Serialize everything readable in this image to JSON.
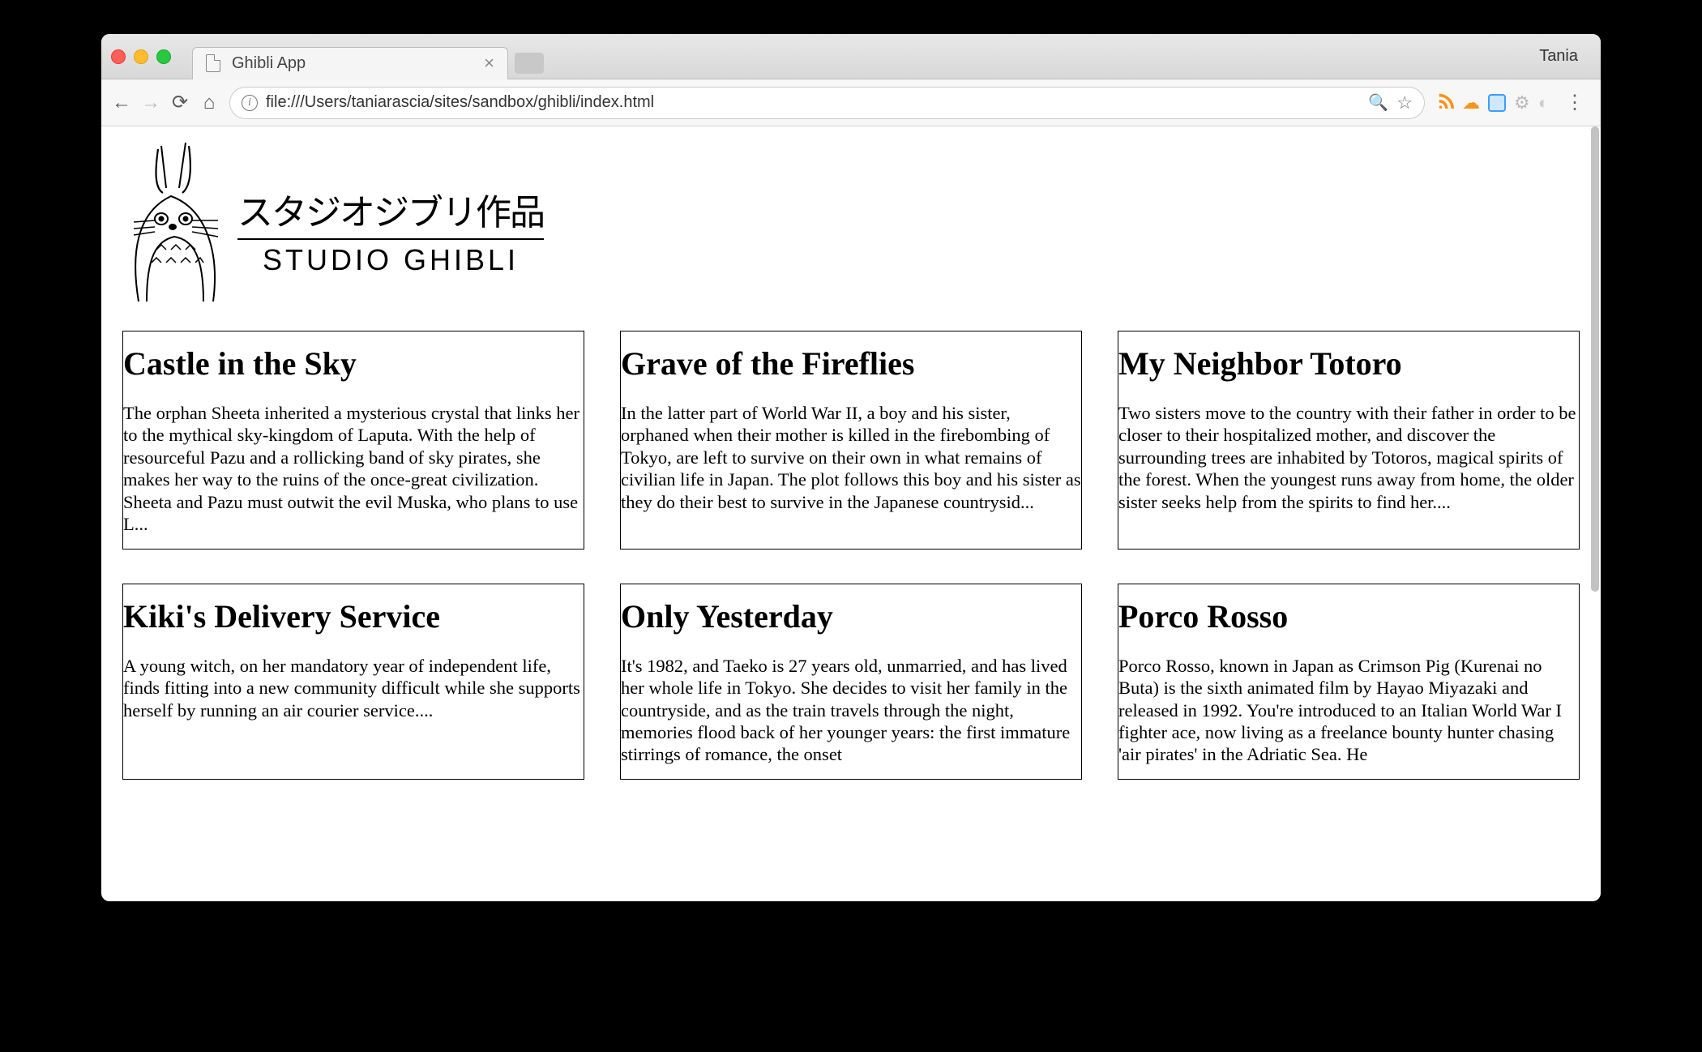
{
  "browser": {
    "tab_title": "Ghibli App",
    "profile_name": "Tania",
    "url": "file:///Users/taniarascia/sites/sandbox/ghibli/index.html"
  },
  "logo": {
    "japanese": "スタジオジブリ作品",
    "english": "STUDIO GHIBLI"
  },
  "films": [
    {
      "title": "Castle in the Sky",
      "description": "The orphan Sheeta inherited a mysterious crystal that links her to the mythical sky-kingdom of Laputa. With the help of resourceful Pazu and a rollicking band of sky pirates, she makes her way to the ruins of the once-great civilization. Sheeta and Pazu must outwit the evil Muska, who plans to use L..."
    },
    {
      "title": "Grave of the Fireflies",
      "description": "In the latter part of World War II, a boy and his sister, orphaned when their mother is killed in the firebombing of Tokyo, are left to survive on their own in what remains of civilian life in Japan. The plot follows this boy and his sister as they do their best to survive in the Japanese countrysid..."
    },
    {
      "title": "My Neighbor Totoro",
      "description": "Two sisters move to the country with their father in order to be closer to their hospitalized mother, and discover the surrounding trees are inhabited by Totoros, magical spirits of the forest. When the youngest runs away from home, the older sister seeks help from the spirits to find her...."
    },
    {
      "title": "Kiki's Delivery Service",
      "description": "A young witch, on her mandatory year of independent life, finds fitting into a new community difficult while she supports herself by running an air courier service...."
    },
    {
      "title": "Only Yesterday",
      "description": "It's 1982, and Taeko is 27 years old, unmarried, and has lived her whole life in Tokyo. She decides to visit her family in the countryside, and as the train travels through the night, memories flood back of her younger years: the first immature stirrings of romance, the onset"
    },
    {
      "title": "Porco Rosso",
      "description": "Porco Rosso, known in Japan as Crimson Pig (Kurenai no Buta) is the sixth animated film by Hayao Miyazaki and released in 1992. You're introduced to an Italian World War I fighter ace, now living as a freelance bounty hunter chasing 'air pirates' in the Adriatic Sea. He"
    }
  ]
}
